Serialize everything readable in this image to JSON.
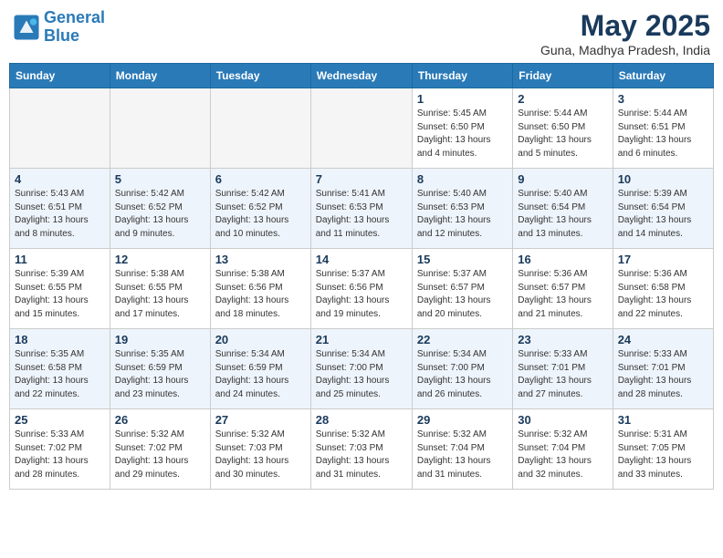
{
  "header": {
    "logo_line1": "General",
    "logo_line2": "Blue",
    "month_title": "May 2025",
    "location": "Guna, Madhya Pradesh, India"
  },
  "weekdays": [
    "Sunday",
    "Monday",
    "Tuesday",
    "Wednesday",
    "Thursday",
    "Friday",
    "Saturday"
  ],
  "weeks": [
    [
      {
        "day": "",
        "info": ""
      },
      {
        "day": "",
        "info": ""
      },
      {
        "day": "",
        "info": ""
      },
      {
        "day": "",
        "info": ""
      },
      {
        "day": "1",
        "info": "Sunrise: 5:45 AM\nSunset: 6:50 PM\nDaylight: 13 hours\nand 4 minutes."
      },
      {
        "day": "2",
        "info": "Sunrise: 5:44 AM\nSunset: 6:50 PM\nDaylight: 13 hours\nand 5 minutes."
      },
      {
        "day": "3",
        "info": "Sunrise: 5:44 AM\nSunset: 6:51 PM\nDaylight: 13 hours\nand 6 minutes."
      }
    ],
    [
      {
        "day": "4",
        "info": "Sunrise: 5:43 AM\nSunset: 6:51 PM\nDaylight: 13 hours\nand 8 minutes."
      },
      {
        "day": "5",
        "info": "Sunrise: 5:42 AM\nSunset: 6:52 PM\nDaylight: 13 hours\nand 9 minutes."
      },
      {
        "day": "6",
        "info": "Sunrise: 5:42 AM\nSunset: 6:52 PM\nDaylight: 13 hours\nand 10 minutes."
      },
      {
        "day": "7",
        "info": "Sunrise: 5:41 AM\nSunset: 6:53 PM\nDaylight: 13 hours\nand 11 minutes."
      },
      {
        "day": "8",
        "info": "Sunrise: 5:40 AM\nSunset: 6:53 PM\nDaylight: 13 hours\nand 12 minutes."
      },
      {
        "day": "9",
        "info": "Sunrise: 5:40 AM\nSunset: 6:54 PM\nDaylight: 13 hours\nand 13 minutes."
      },
      {
        "day": "10",
        "info": "Sunrise: 5:39 AM\nSunset: 6:54 PM\nDaylight: 13 hours\nand 14 minutes."
      }
    ],
    [
      {
        "day": "11",
        "info": "Sunrise: 5:39 AM\nSunset: 6:55 PM\nDaylight: 13 hours\nand 15 minutes."
      },
      {
        "day": "12",
        "info": "Sunrise: 5:38 AM\nSunset: 6:55 PM\nDaylight: 13 hours\nand 17 minutes."
      },
      {
        "day": "13",
        "info": "Sunrise: 5:38 AM\nSunset: 6:56 PM\nDaylight: 13 hours\nand 18 minutes."
      },
      {
        "day": "14",
        "info": "Sunrise: 5:37 AM\nSunset: 6:56 PM\nDaylight: 13 hours\nand 19 minutes."
      },
      {
        "day": "15",
        "info": "Sunrise: 5:37 AM\nSunset: 6:57 PM\nDaylight: 13 hours\nand 20 minutes."
      },
      {
        "day": "16",
        "info": "Sunrise: 5:36 AM\nSunset: 6:57 PM\nDaylight: 13 hours\nand 21 minutes."
      },
      {
        "day": "17",
        "info": "Sunrise: 5:36 AM\nSunset: 6:58 PM\nDaylight: 13 hours\nand 22 minutes."
      }
    ],
    [
      {
        "day": "18",
        "info": "Sunrise: 5:35 AM\nSunset: 6:58 PM\nDaylight: 13 hours\nand 22 minutes."
      },
      {
        "day": "19",
        "info": "Sunrise: 5:35 AM\nSunset: 6:59 PM\nDaylight: 13 hours\nand 23 minutes."
      },
      {
        "day": "20",
        "info": "Sunrise: 5:34 AM\nSunset: 6:59 PM\nDaylight: 13 hours\nand 24 minutes."
      },
      {
        "day": "21",
        "info": "Sunrise: 5:34 AM\nSunset: 7:00 PM\nDaylight: 13 hours\nand 25 minutes."
      },
      {
        "day": "22",
        "info": "Sunrise: 5:34 AM\nSunset: 7:00 PM\nDaylight: 13 hours\nand 26 minutes."
      },
      {
        "day": "23",
        "info": "Sunrise: 5:33 AM\nSunset: 7:01 PM\nDaylight: 13 hours\nand 27 minutes."
      },
      {
        "day": "24",
        "info": "Sunrise: 5:33 AM\nSunset: 7:01 PM\nDaylight: 13 hours\nand 28 minutes."
      }
    ],
    [
      {
        "day": "25",
        "info": "Sunrise: 5:33 AM\nSunset: 7:02 PM\nDaylight: 13 hours\nand 28 minutes."
      },
      {
        "day": "26",
        "info": "Sunrise: 5:32 AM\nSunset: 7:02 PM\nDaylight: 13 hours\nand 29 minutes."
      },
      {
        "day": "27",
        "info": "Sunrise: 5:32 AM\nSunset: 7:03 PM\nDaylight: 13 hours\nand 30 minutes."
      },
      {
        "day": "28",
        "info": "Sunrise: 5:32 AM\nSunset: 7:03 PM\nDaylight: 13 hours\nand 31 minutes."
      },
      {
        "day": "29",
        "info": "Sunrise: 5:32 AM\nSunset: 7:04 PM\nDaylight: 13 hours\nand 31 minutes."
      },
      {
        "day": "30",
        "info": "Sunrise: 5:32 AM\nSunset: 7:04 PM\nDaylight: 13 hours\nand 32 minutes."
      },
      {
        "day": "31",
        "info": "Sunrise: 5:31 AM\nSunset: 7:05 PM\nDaylight: 13 hours\nand 33 minutes."
      }
    ]
  ]
}
